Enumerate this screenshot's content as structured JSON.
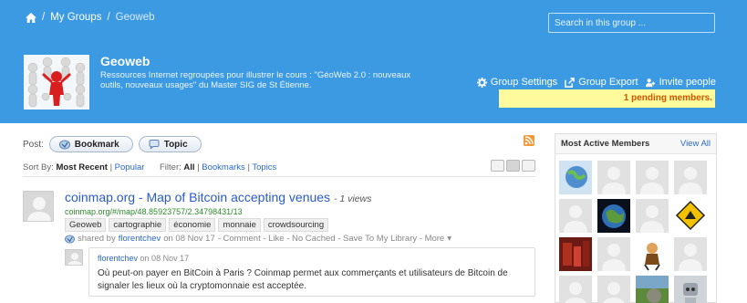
{
  "breadcrumb": {
    "items": [
      "My Groups"
    ],
    "current": "Geoweb",
    "sep": "/"
  },
  "search": {
    "placeholder": "Search in this group ..."
  },
  "group": {
    "title": "Geoweb",
    "description": "Ressources Internet regroupées pour illustrer le cours : \"GéoWeb 2.0 : nouveaux outils, nouveaux usages\" du Master SIG de St Étienne."
  },
  "actions": {
    "settings": "Group Settings",
    "export": "Group Export",
    "invite": "Invite people"
  },
  "pending": "1 pending members.",
  "post": {
    "label": "Post:",
    "bookmark": "Bookmark",
    "topic": "Topic"
  },
  "sort": {
    "label": "Sort By:",
    "most_recent": "Most Recent",
    "popular": "Popular",
    "sep": "|"
  },
  "filter": {
    "label": "Filter:",
    "all": "All",
    "bookmarks": "Bookmarks",
    "topics": "Topics"
  },
  "bookmark": {
    "title": "coinmap.org - Map of Bitcoin accepting venues",
    "views": "- 1 views",
    "url": "coinmap.org/#/map/48.85923757/2.34798431/13",
    "tags": [
      "Geoweb",
      "cartographie",
      "économie",
      "monnaie",
      "crowdsourcing"
    ],
    "shared_by": "shared by",
    "user": "florentchev",
    "date": "on 08 Nov 17",
    "actions": "- Comment - Like - No Cached - Save To My Library - More",
    "more_arrow": "▾"
  },
  "comment": {
    "user": "florentchev",
    "date": "on 08 Nov 17",
    "text": "Où peut-on payer en BitCoin à Paris ? Coinmap permet aux commerçants et utilisateurs de Bitcoin de signaler les lieux où la cryptomonnaie est acceptée."
  },
  "sidebar": {
    "title": "Most Active Members",
    "view_all": "View All",
    "members": [
      "globe-avatar",
      "default-avatar",
      "default-avatar",
      "default-avatar",
      "default-avatar",
      "earth-avatar",
      "default-avatar",
      "warning-sign-avatar",
      "photo-avatar",
      "default-avatar",
      "cartoon-avatar",
      "default-avatar",
      "default-avatar",
      "default-avatar",
      "landscape-avatar",
      "robot-avatar"
    ]
  },
  "colors": {
    "header": "#3b9ae1",
    "link": "#2a5bc9",
    "url": "#2c8a2c",
    "pending_bg": "#fffb9c",
    "pending_text": "#d35400"
  }
}
